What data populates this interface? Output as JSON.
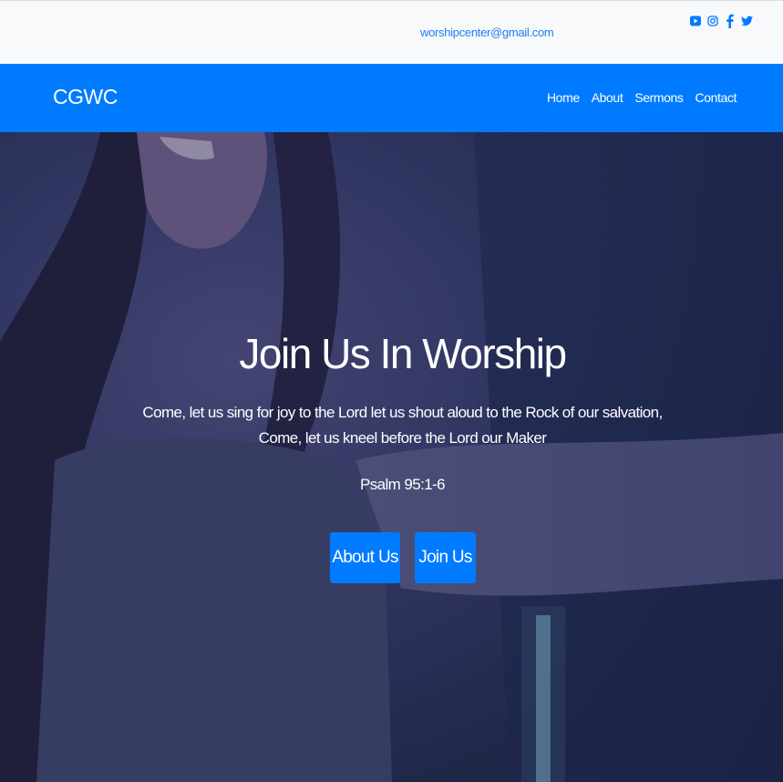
{
  "topbar": {
    "email": "worshipcenter@gmail.com",
    "social_icons": [
      "youtube-icon",
      "instagram-icon",
      "facebook-icon",
      "twitter-icon"
    ]
  },
  "navbar": {
    "brand": "CGWC",
    "links": [
      "Home",
      "About",
      "Sermons",
      "Contact"
    ]
  },
  "hero": {
    "title": "Join Us In Worship",
    "verse_line1": "Come, let us sing for joy to the Lord let us shout aloud to the Rock of our salvation,",
    "verse_line2": "Come, let us kneel before the Lord our Maker",
    "reference": "Psalm 95:1-6",
    "buttons": {
      "about": "About Us",
      "join": "Join Us"
    }
  },
  "colors": {
    "primary": "#007bff",
    "topbar_bg": "#f8f9fa",
    "hero_tint": "#2c3452"
  }
}
